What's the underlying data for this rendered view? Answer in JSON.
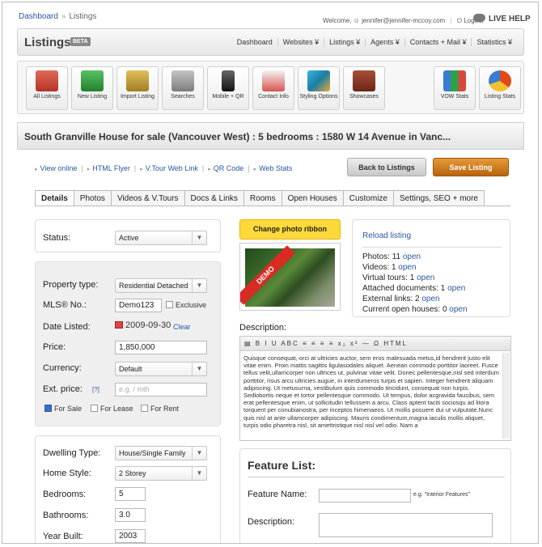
{
  "topbar": {
    "crumb_1": "Dashboard",
    "crumb_sep": "»",
    "crumb_2": "Listings",
    "welcome": "Welcome,",
    "user": "jennifer@jennifer-mccoy.com",
    "logout": "Logout",
    "live_help": "LIVE HELP"
  },
  "header": {
    "brand": "Listings",
    "beta": "BETA",
    "nav": [
      "Dashboard",
      "Websites ¥",
      "Listings ¥",
      "Agents ¥",
      "Contacts + Mail ¥",
      "Statistics ¥"
    ]
  },
  "toolbar": {
    "items": [
      {
        "label": "All Listings",
        "icon": "house-icon",
        "color": "#c0392b"
      },
      {
        "label": "New Listing",
        "icon": "add-house-icon",
        "color": "#2e9b3a"
      },
      {
        "label": "Import Listing",
        "icon": "box-import-icon",
        "color": "#c8a03a"
      },
      {
        "label": "Searches",
        "icon": "binoculars-icon",
        "color": "#8c8c8c"
      },
      {
        "label": "Mobile + QR",
        "icon": "phone-icon",
        "color": "#333333"
      },
      {
        "label": "Contact Info",
        "icon": "contact-card-icon",
        "color": "#d9534f"
      },
      {
        "label": "Styling Options",
        "icon": "palette-icon",
        "color": "#2aa3c7"
      },
      {
        "label": "Showcases",
        "icon": "album-icon",
        "color": "#8b3a2a"
      },
      {
        "label": "VOW Stats",
        "icon": "bar-chart-icon",
        "color": "#3a7bd5"
      },
      {
        "label": "Listing Stats",
        "icon": "pie-chart-icon",
        "color": "#e04a1a"
      }
    ]
  },
  "listing": {
    "title": "South Granville House for sale (Vancouver West) : 5 bedrooms : 1580 W 14 Avenue in Vanc..."
  },
  "quick_links": [
    "View online",
    "HTML Flyer",
    "V.Tour Web Link",
    "QR Code",
    "Web Stats"
  ],
  "buttons": {
    "back": "Back to Listings",
    "save": "Save Listing"
  },
  "tabs": [
    "Details",
    "Photos",
    "Videos & V.Tours",
    "Docs & Links",
    "Rooms",
    "Open Houses",
    "Customize",
    "Settings, SEO + more"
  ],
  "status_panel": {
    "label": "Status:",
    "value": "Active"
  },
  "property_panel": {
    "type_label": "Property type:",
    "type_value": "Residential Detached",
    "mls_label": "MLS® No.:",
    "mls_value": "Demo123",
    "exclusive": "Exclusive",
    "date_label": "Date Listed:",
    "date_value": "2009-09-30",
    "clear": "Clear",
    "price_label": "Price:",
    "price_value": "1,850,000",
    "currency_label": "Currency:",
    "currency_value": "Default",
    "ext_label": "Ext. price:",
    "ext_help": "[?]",
    "ext_placeholder": "e.g. / mth",
    "for_sale": "For Sale",
    "for_lease": "For Lease",
    "for_rent": "For Rent"
  },
  "dwelling_panel": {
    "dwelling_label": "Dwelling Type:",
    "dwelling_value": "House/Single Family",
    "style_label": "Home Style:",
    "style_value": "2 Storey",
    "bed_label": "Bedrooms:",
    "bed_value": "5",
    "bath_label": "Bathrooms:",
    "bath_value": "3.0",
    "year_label": "Year Built:",
    "year_value": "2003"
  },
  "photo": {
    "ribbon_button": "Change photo ribbon",
    "ribbon_text": "DEMO"
  },
  "media_stats": {
    "reload": "Reload listing",
    "rows": [
      {
        "text": "Photos: 11",
        "link": "open"
      },
      {
        "text": "Videos: 1",
        "link": "open"
      },
      {
        "text": "Virtual tours: 1",
        "link": "open"
      },
      {
        "text": "Attached documents: 1",
        "link": "open"
      },
      {
        "text": "External links: 2",
        "link": "open"
      },
      {
        "text": "Current open houses: 0",
        "link": "open"
      }
    ]
  },
  "description": {
    "label": "Description:",
    "toolbar": "B I U ABC ≡ ≡ ≡ ≡ x₂ x² — Ω HTML",
    "text": "Quisque consequat, orci at ultricies auctor, sem eros malesuada metus,id hendrerit justo elit vitae enim. Proin mattis sagittis ligulasodales aliquet. Aenean commodo porttitor laoreet. Fusce tellus velit,ullamcorper non ultrices ut, pulvinar vitae velit. Donec pellentesque,nisl sed interdum porttitor, risus arcu ultricies augue, in interdumeros turpis et sapien. Integer hendrerit aliquam adipiscing. Ut metusurna, vestibulum quis commodo tincidunt, consequat non turpis. Sedlobortis neque et tortor pellentesque commodo. Ut tempus, dolor acgravida faucibus, sem erat pellentesque enim, ut sollicitudin tellussem a arcu. Class aptent taciti sociosqu ad litora torquent per conubianostra, per inceptos himenaeos. Ut mollis posuere dui ut vulputate.Nunc quis nisl at ante ullamcorper adipiscing. Mauris condimentum,magna iaculis mollis aliquet, turpis odio pharetra nisl, sit amettristique nisl nisl vel odio. Nam a"
  },
  "feature": {
    "title": "Feature List:",
    "name_label": "Feature Name:",
    "name_hint": "e.g. \"Interior Features\"",
    "desc_label": "Description:"
  }
}
